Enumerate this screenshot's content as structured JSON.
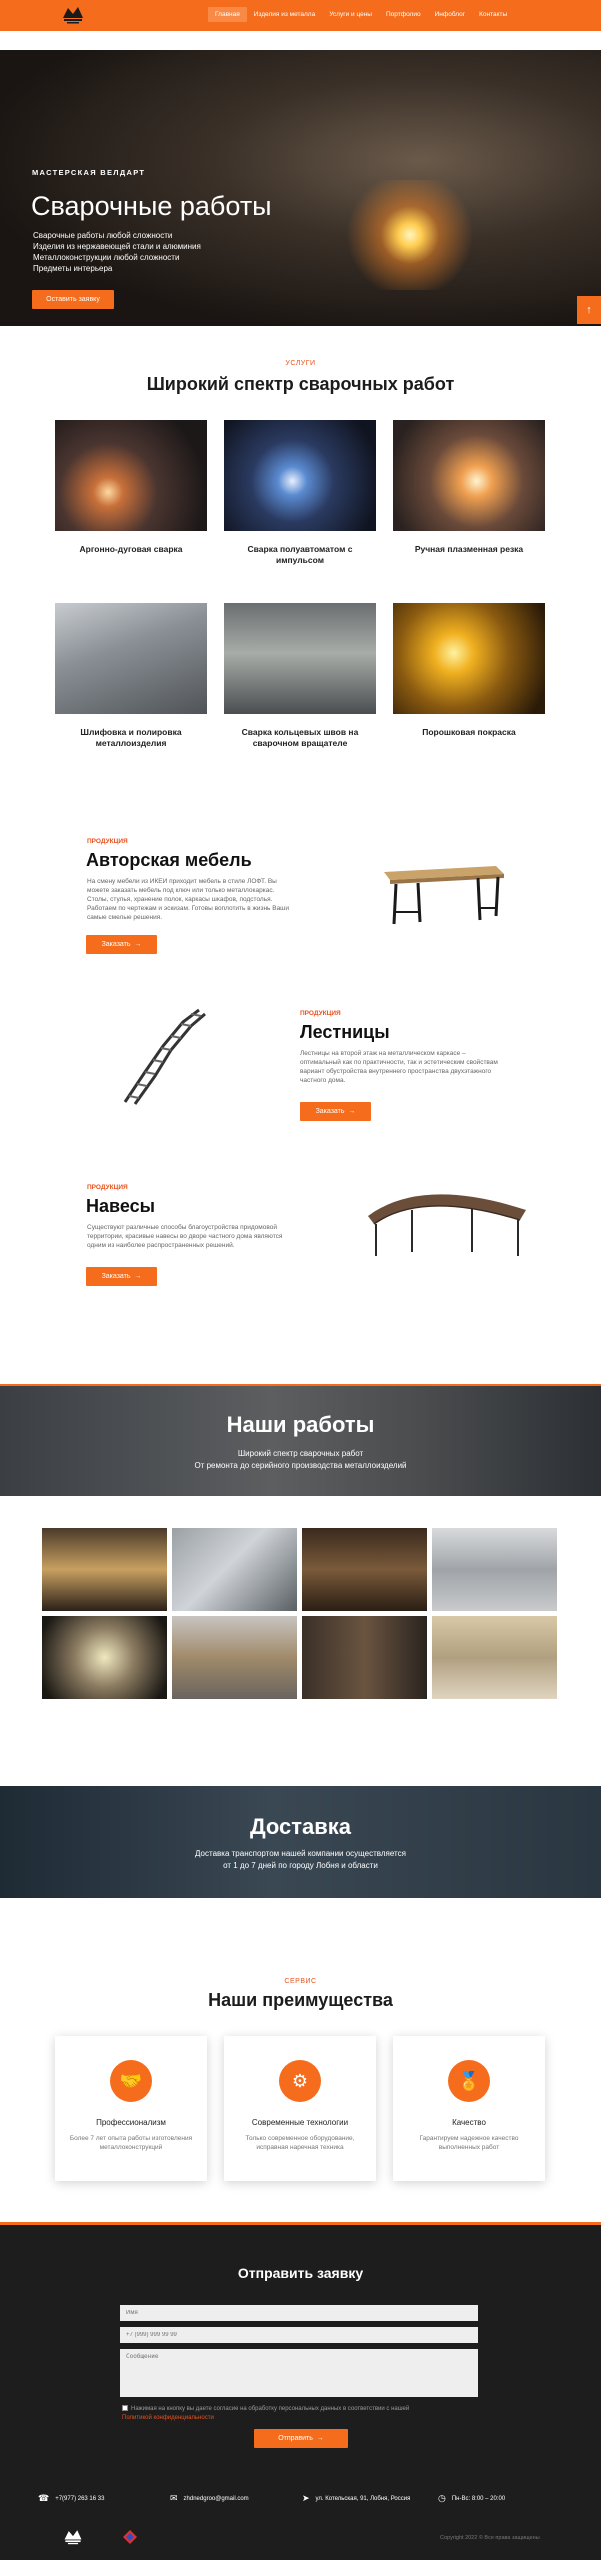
{
  "nav": {
    "items": [
      "Главная",
      "Изделия из металла",
      "Услуги и цены",
      "Портфолио",
      "Инфоблог",
      "Контакты"
    ]
  },
  "hero": {
    "subtitle": "МАСТЕРСКАЯ ВЕЛДАРТ",
    "title": "Сварочные работы",
    "lines": [
      "Сварочные работы любой сложности",
      "Изделия из нержавеющей стали и алюминия",
      "Металлоконструкции любой сложности",
      "Предметы интерьера"
    ],
    "button": "Оставить заявку",
    "scroll_icon": "↑"
  },
  "services": {
    "tag": "УСЛУГИ",
    "title": "Широкий спектр сварочных работ",
    "items": [
      {
        "label": "Аргонно-дуговая сварка"
      },
      {
        "label": "Сварка полуавтоматом с импульсом"
      },
      {
        "label": "Ручная плазменная резка"
      },
      {
        "label": "Шлифовка и полировка металлоизделия"
      },
      {
        "label": "Сварка кольцевых швов на сварочном вращателе"
      },
      {
        "label": "Порошковая покраска"
      }
    ]
  },
  "products": [
    {
      "tag": "ПРОДУКЦИЯ",
      "title": "Авторская мебель",
      "text": "На смену мебели из ИКЕИ приходит мебель в стиле ЛОФТ. Вы можете заказать мебель под ключ или только металлокаркас. Столы, стулья, хранение полок, каркасы шкафов, подстолья. Работаем по чертежам и эскизам. Готовы воплотить в жизнь Ваши самые смелые решения.",
      "button": "Заказать"
    },
    {
      "tag": "ПРОДУКЦИЯ",
      "title": "Лестницы",
      "text": "Лестницы на второй этаж на металлическом каркасе – оптимальный как по практичности, так и эстетическим свойствам вариант обустройства внутреннего пространства двухэтажного частного дома.",
      "button": "Заказать"
    },
    {
      "tag": "ПРОДУКЦИЯ",
      "title": "Навесы",
      "text": "Существуют различные способы благоустройства придомовой территории, красивые навесы во дворе частного дома являются одним из наиболее распространенных решений.",
      "button": "Заказать"
    }
  ],
  "works": {
    "title": "Наши работы",
    "lines": [
      "Широкий спектр сварочных работ",
      "От ремонта до серийного производства металлоизделий"
    ]
  },
  "delivery": {
    "title": "Доставка",
    "lines": [
      "Доставка транспортом нашей компании осуществляется",
      "от 1 до 7 дней по городу Лобня и области"
    ]
  },
  "advantages": {
    "tag": "СЕРВИС",
    "title": "Наши преимущества",
    "items": [
      {
        "icon": "handshake-icon",
        "glyph": "🤝",
        "title": "Профессионализм",
        "text": "Более 7 лет опыта работы изготовления металлоконструкций"
      },
      {
        "icon": "gear-icon",
        "glyph": "⚙",
        "title": "Современные технологии",
        "text": "Только современное оборудование, исправная наречная техника"
      },
      {
        "icon": "medal-icon",
        "glyph": "🏅",
        "title": "Качество",
        "text": "Гарантируем надежное качество выполненных работ"
      }
    ]
  },
  "form": {
    "title": "Отправить заявку",
    "name_placeholder": "Имя",
    "phone_placeholder": "+7 (999) 999 99 99",
    "message_placeholder": "Сообщение",
    "agree_text": "Нажимая на кнопку вы даете согласие на обработку персональных данных в соответствии с нашей",
    "agree_link": "Политикой конфиденциальности",
    "button": "Отправить"
  },
  "contacts": {
    "phone": "+7(977) 263 16 33",
    "email": "zhdnedgroo@gmail.com",
    "address": "ул. Котельская, 91, Лобня, Россия",
    "hours": "Пн-Вс: 8:00 – 20:00"
  },
  "footer": {
    "copyright": "Copyright 2022 © Все права защищены"
  },
  "colors": {
    "accent": "#f56c1c",
    "dark": "#1d1d1d"
  }
}
